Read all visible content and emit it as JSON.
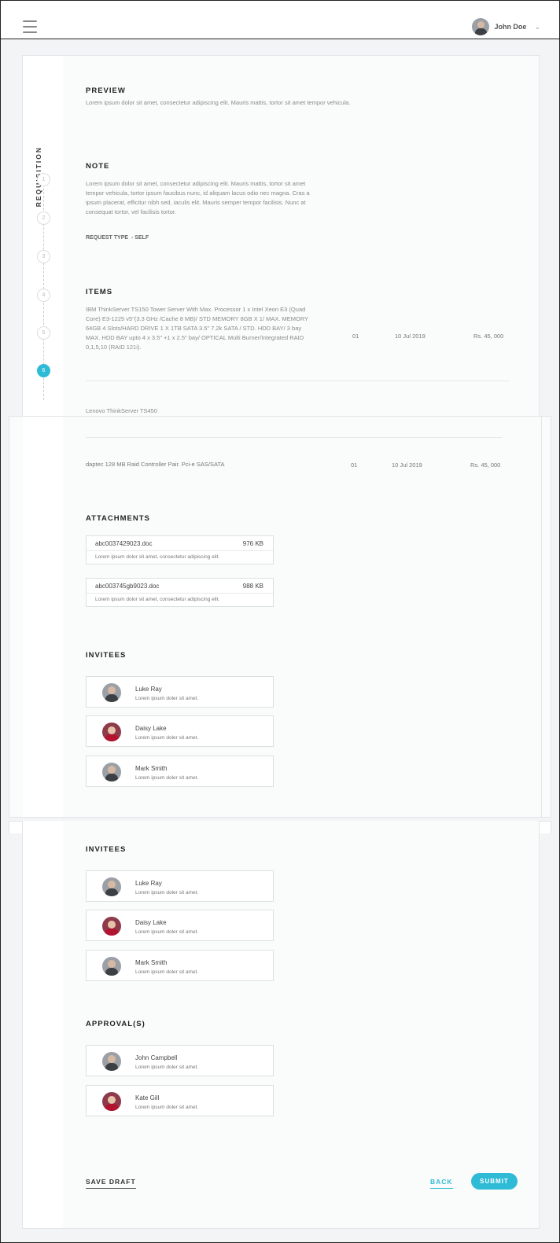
{
  "header": {
    "user_name": "John Doe"
  },
  "rail": {
    "title": "REQUISITION",
    "steps": [
      "1",
      "2",
      "3",
      "4",
      "5",
      "6"
    ]
  },
  "preview": {
    "title": "PREVIEW",
    "text": "Lorem ipsum dolor sit amet, consectetur adipiscing elit. Mauris mattis, tortor sit amet tempor vehicula."
  },
  "note": {
    "title": "NOTE",
    "text": "Lorem ipsum dolor sit amet, consectetur adipiscing elit. Mauris mattis, tortor sit amet tempor vehicula, tortor ipsum faucibus nunc, id aliquam lacus odio nec magna. Cras a ipsum placerat, efficitur nibh sed, iaculis elit. Mauris semper tempor facilisis. Nunc at consequat tortor, vel facilisis tortor.",
    "request_type": "REQUEST TYPE  - SELF"
  },
  "items": {
    "title": "ITEMS",
    "rows": [
      {
        "desc": "IBM ThinkServer TS150 Tower Server With Max. Processor 1 x Intel Xeon E3 (Quad Core) E3-1225 v5\"(3.3 GHz /Cache 8 MB)/ STD MEMORY 8GB X 1/ MAX. MEMORY 64GB 4 Slots/HARD DRIVE 1 X 1TB SATA 3.5\" 7.2k SATA / STD. HDD BAY/ 3 bay MAX. HDD BAY upto 4 x 3.5\" +1 x 2.5\" bay/ OPTICAL Multi Burner/Integrated RAID 0,1,5,10 (RAID 121i).",
        "qty": "01",
        "date": "10 Jul 2019",
        "price": "Rs. 45, 000"
      },
      {
        "desc": "Lenovo ThinkServer TS450"
      },
      {
        "desc": "daptec 128 MB Raid Controller Pair. Pci-e SAS/SATA",
        "qty": "01",
        "date": "10 Jul 2019",
        "price": "Rs. 45, 000"
      }
    ]
  },
  "attachments": {
    "title": "ATTACHMENTS",
    "files": [
      {
        "name": "abc0037429023.doc",
        "size": "976 KB",
        "desc": "Lorem ipsum dolor sit amet, consectetur adipiscing elit."
      },
      {
        "name": "abc003745gb9023.doc",
        "size": "988 KB",
        "desc": "Lorem ipsum dolor sit amet, consectetur adipiscing elit."
      }
    ]
  },
  "invitees": {
    "title": "INVITEES",
    "people": [
      {
        "name": "Luke Ray",
        "desc": "Lorem ipsum doler sit amet."
      },
      {
        "name": "Daisy Lake",
        "desc": "Lorem ipsum doler sit amet."
      },
      {
        "name": "Mark Smith",
        "desc": "Lorem ipsum doler sit amet."
      }
    ]
  },
  "approvals": {
    "title": "APPROVAL(S)",
    "people": [
      {
        "name": "John Campbell",
        "desc": "Lorem ipsum doler sit amet."
      },
      {
        "name": "Kate Gill",
        "desc": "Lorem ipsum doler sit amet."
      }
    ]
  },
  "actions": {
    "save_draft": "SAVE DRAFT",
    "back": "BACK",
    "submit": "SUBMIT"
  }
}
